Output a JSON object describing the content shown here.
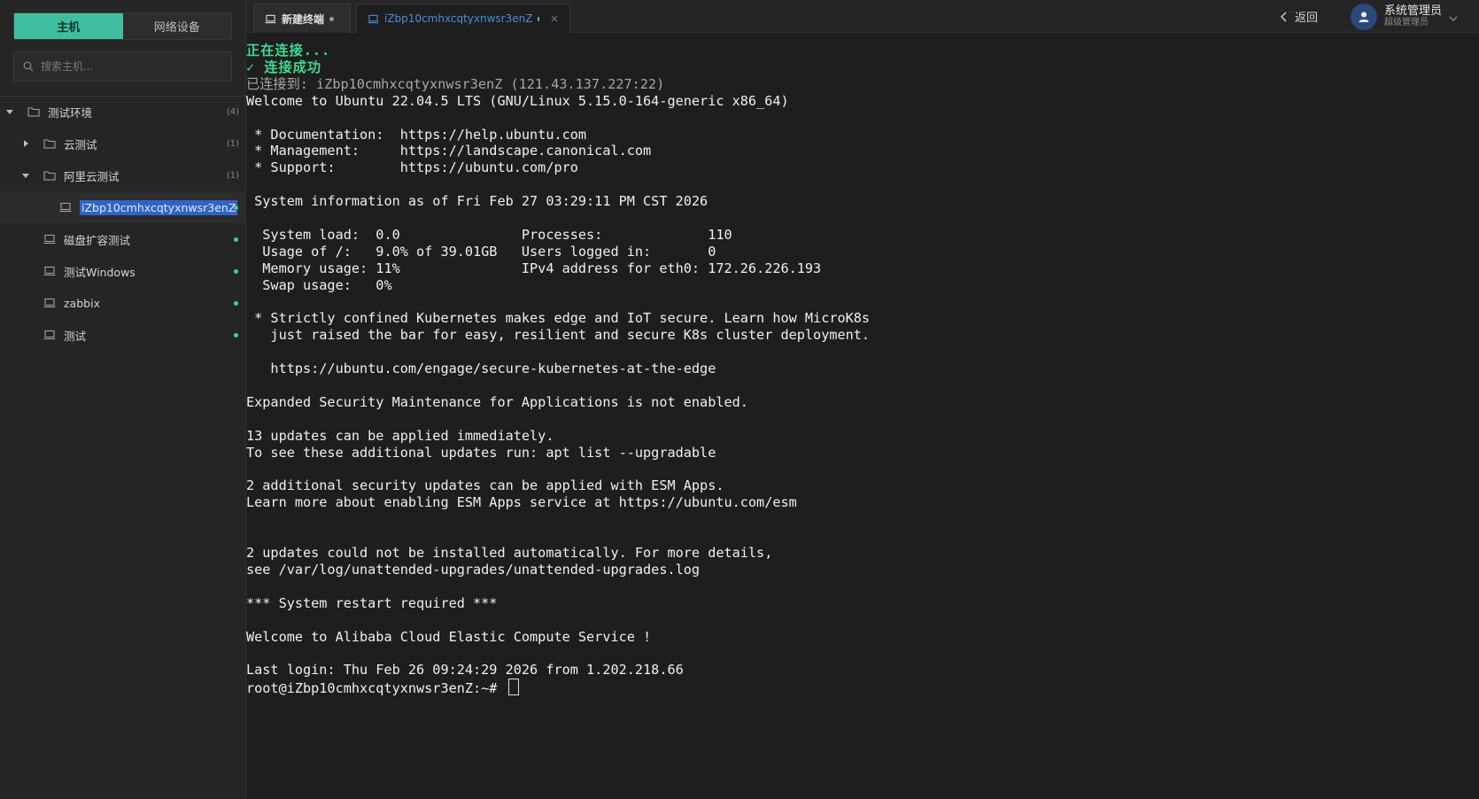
{
  "sidebar": {
    "tabs": [
      {
        "label": "主机",
        "active": true
      },
      {
        "label": "网络设备",
        "active": false
      }
    ],
    "search": {
      "placeholder": "搜索主机..."
    },
    "tree": [
      {
        "label": "测试环境",
        "count": "(4)",
        "type": "folder",
        "expanded": true,
        "level": 0
      },
      {
        "label": "云测试",
        "count": "(1)",
        "type": "folder",
        "expanded": false,
        "level": 1
      },
      {
        "label": "阿里云测试",
        "count": "(1)",
        "type": "folder",
        "expanded": true,
        "level": 1
      },
      {
        "label": "iZbp10cmhxcqtyxnwsr3enZ",
        "type": "host",
        "level": 2,
        "selected": true,
        "online": true
      },
      {
        "label": "磁盘扩容测试",
        "type": "host",
        "level": 1,
        "online": true
      },
      {
        "label": "测试Windows",
        "type": "host",
        "level": 1,
        "online": true
      },
      {
        "label": "zabbix",
        "type": "host",
        "level": 1,
        "online": true
      },
      {
        "label": "测试",
        "type": "host",
        "level": 1,
        "online": true
      }
    ]
  },
  "topbar": {
    "tabs": [
      {
        "label": "新建终端",
        "active": false,
        "dot_color": "#9a9a9a"
      },
      {
        "label": "iZbp10cmhxcqtyxnwsr3enZ",
        "active": true,
        "dot_color": "#3fd0a0",
        "close": "×"
      }
    ],
    "back_label": "返回",
    "user": {
      "name": "系统管理员",
      "role": "超级管理员"
    }
  },
  "terminal": {
    "status_connecting": "正在连接...",
    "status_success": "✓ 连接成功",
    "connected_to": "已连接到: iZbp10cmhxcqtyxnwsr3enZ (121.43.137.227:22)",
    "lines": [
      "Welcome to Ubuntu 22.04.5 LTS (GNU/Linux 5.15.0-164-generic x86_64)",
      "",
      " * Documentation:  https://help.ubuntu.com",
      " * Management:     https://landscape.canonical.com",
      " * Support:        https://ubuntu.com/pro",
      "",
      " System information as of Fri Feb 27 03:29:11 PM CST 2026",
      "",
      "  System load:  0.0               Processes:             110",
      "  Usage of /:   9.0% of 39.01GB   Users logged in:       0",
      "  Memory usage: 11%               IPv4 address for eth0: 172.26.226.193",
      "  Swap usage:   0%",
      "",
      " * Strictly confined Kubernetes makes edge and IoT secure. Learn how MicroK8s",
      "   just raised the bar for easy, resilient and secure K8s cluster deployment.",
      "",
      "   https://ubuntu.com/engage/secure-kubernetes-at-the-edge",
      "",
      "Expanded Security Maintenance for Applications is not enabled.",
      "",
      "13 updates can be applied immediately.",
      "To see these additional updates run: apt list --upgradable",
      "",
      "2 additional security updates can be applied with ESM Apps.",
      "Learn more about enabling ESM Apps service at https://ubuntu.com/esm",
      "",
      "",
      "2 updates could not be installed automatically. For more details,",
      "see /var/log/unattended-upgrades/unattended-upgrades.log",
      "",
      "*** System restart required ***",
      "",
      "Welcome to Alibaba Cloud Elastic Compute Service !",
      "",
      "Last login: Thu Feb 26 09:24:29 2026 from 1.202.218.66"
    ],
    "prompt": "root@iZbp10cmhxcqtyxnwsr3enZ:~#"
  },
  "colors": {
    "accent": "#3fbfa0",
    "online": "#3fd0a0",
    "terminal_bg": "#1e1e1e",
    "selection": "#2f64c9"
  }
}
